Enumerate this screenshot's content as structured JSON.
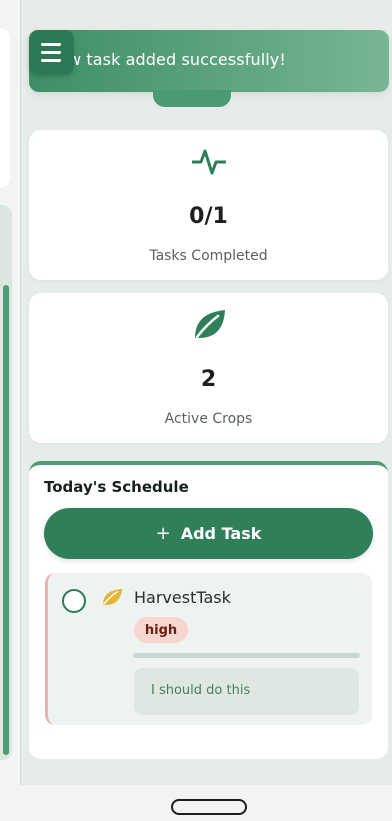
{
  "toast": {
    "message": "w task added successfully!"
  },
  "stats": [
    {
      "value": "0/1",
      "label": "Tasks Completed",
      "icon": "activity-pulse-icon"
    },
    {
      "value": "2",
      "label": "Active Crops",
      "icon": "leaf-icon"
    }
  ],
  "schedule": {
    "title": "Today's Schedule",
    "add_button": {
      "plus": "+",
      "label": "Add Task"
    },
    "tasks": [
      {
        "name": "HarvestTask",
        "priority": "high",
        "progress": 0,
        "note": "I should do this",
        "icon": "leaf-icon"
      }
    ]
  },
  "colors": {
    "accent": "#2f7f59",
    "accent_light": "#4f9c76",
    "priority_high_bg": "#f7d6cf",
    "leaf_yellow": "#e6b53a"
  }
}
